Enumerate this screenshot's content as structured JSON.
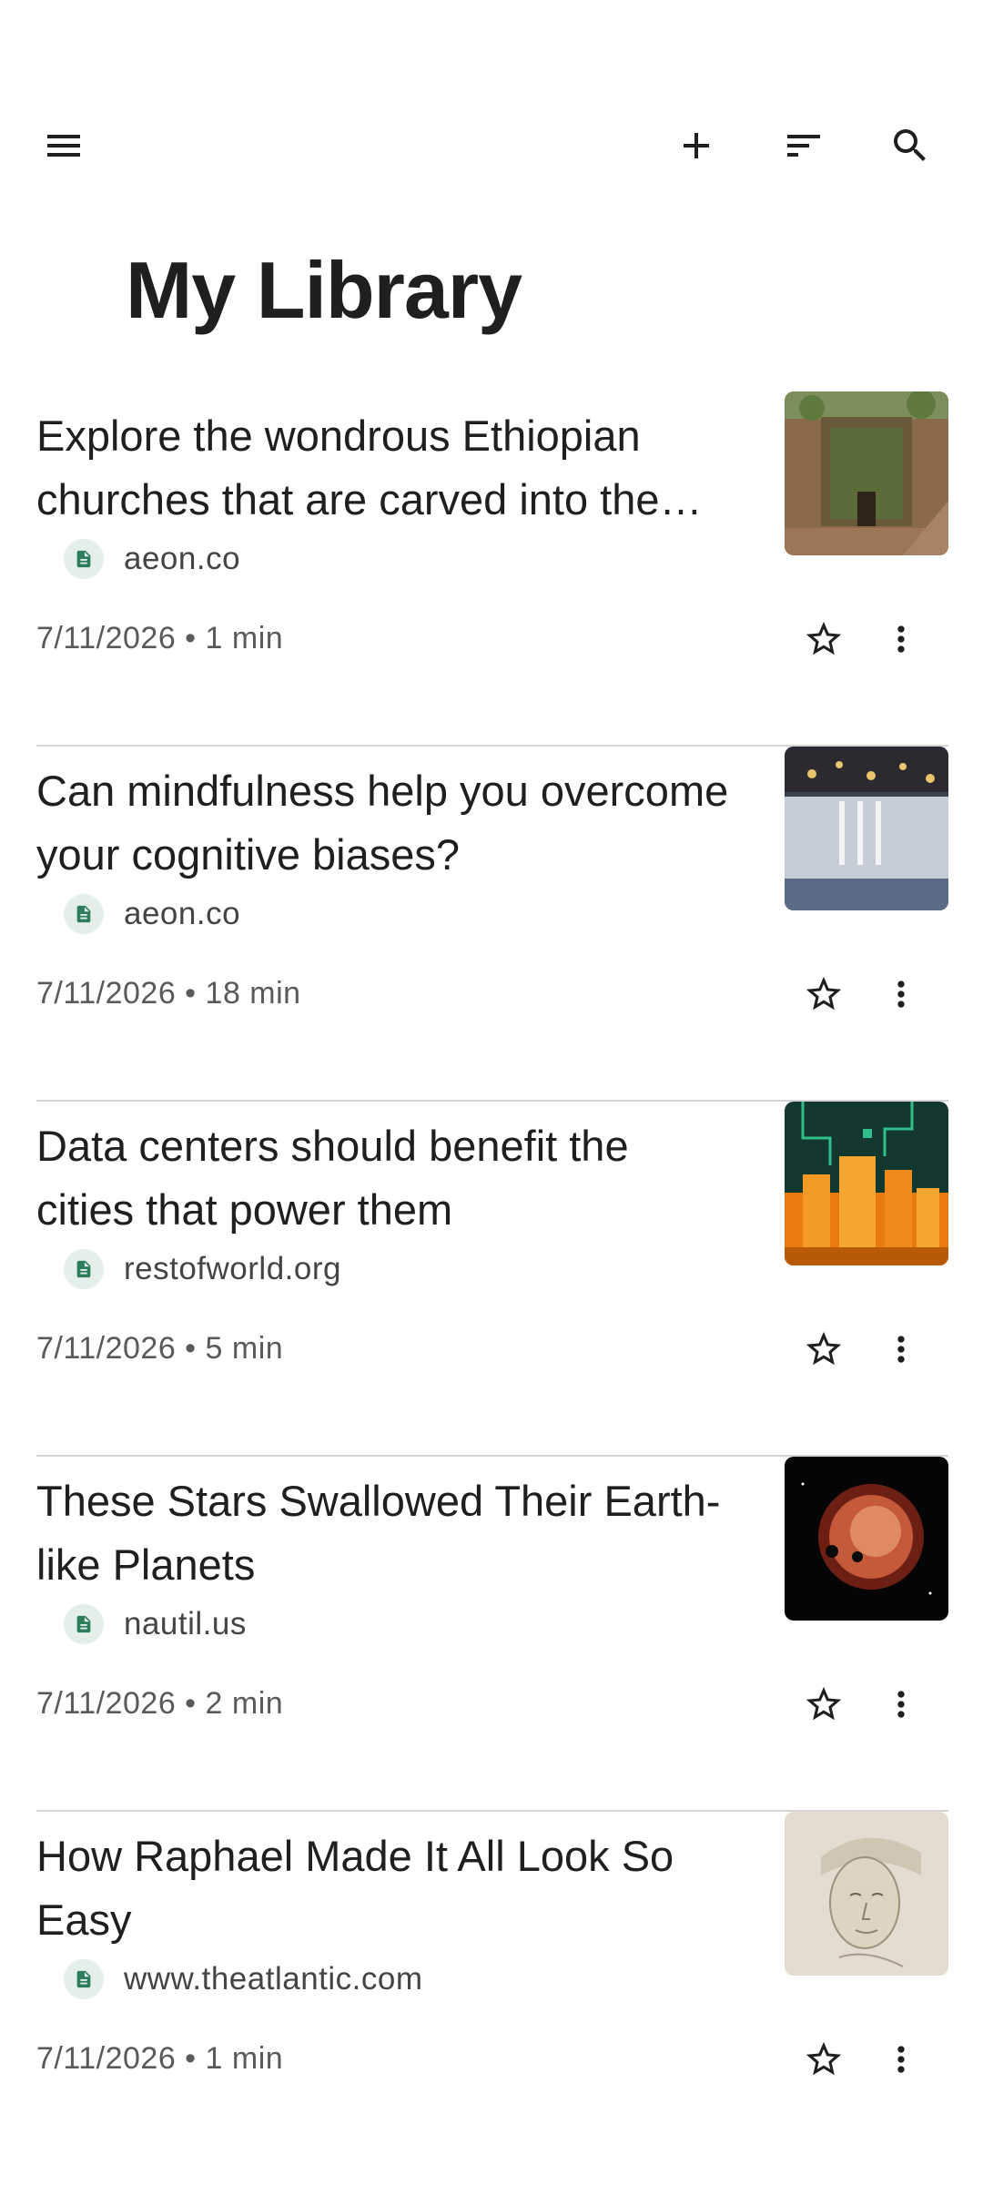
{
  "header": {
    "title": "My Library",
    "icons": [
      "menu-icon",
      "add-icon",
      "sort-icon",
      "search-icon"
    ]
  },
  "articles": [
    {
      "title": "Explore the wondrous Ethiopian churches that are carved into the rock",
      "source": "aeon.co",
      "date": "7/11/2026",
      "read_time": "1 min",
      "meta": "7/11/2026 • 1 min"
    },
    {
      "title": "Can mindfulness help you overcome your cognitive biases?",
      "source": "aeon.co",
      "date": "7/11/2026",
      "read_time": "18 min",
      "meta": "7/11/2026 • 18 min"
    },
    {
      "title": "Data centers should benefit the cities that power them",
      "source": "restofworld.org",
      "date": "7/11/2026",
      "read_time": "5 min",
      "meta": "7/11/2026 • 5 min"
    },
    {
      "title": "These Stars Swallowed Their Earth-like Planets",
      "source": "nautil.us",
      "date": "7/11/2026",
      "read_time": "2 min",
      "meta": "7/11/2026 • 2 min"
    },
    {
      "title": "How Raphael Made It All Look So Easy",
      "source": "www.theatlantic.com",
      "date": "7/11/2026",
      "read_time": "1 min",
      "meta": "7/11/2026 • 1 min"
    }
  ],
  "colors": {
    "text": "#1f1f1f",
    "secondary_text": "#5a5a5a",
    "divider": "#d6d6d6",
    "source_badge_bg": "#e3efe8",
    "source_badge_icon": "#2e7d5b"
  }
}
